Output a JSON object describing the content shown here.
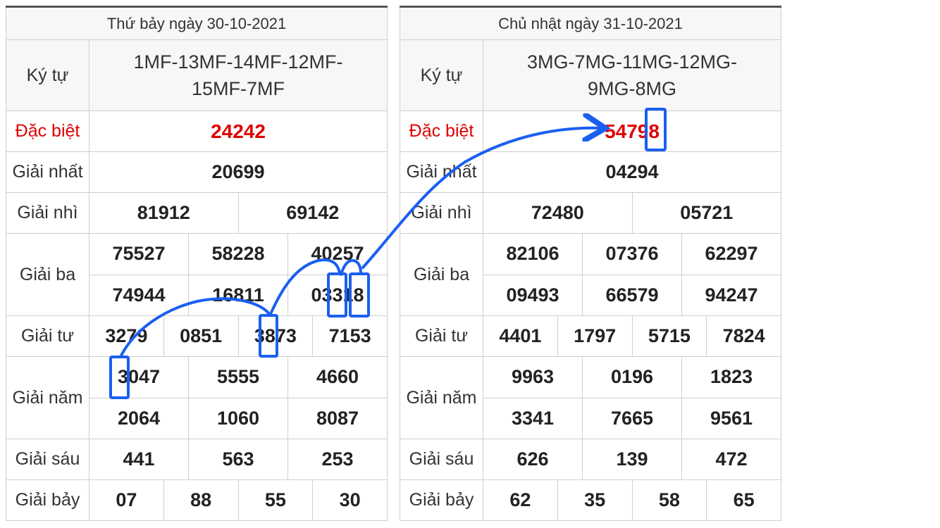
{
  "tables": [
    {
      "date_header": "Thứ bảy ngày 30-10-2021",
      "kytu_label": "Ký tự",
      "kytu_line1": "1MF-13MF-14MF-12MF-",
      "kytu_line2": "15MF-7MF",
      "special_label": "Đặc biệt",
      "special": "24242",
      "first_label": "Giải nhất",
      "first": "20699",
      "second_label": "Giải nhì",
      "second": [
        "81912",
        "69142"
      ],
      "third_label": "Giải ba",
      "third": [
        "75527",
        "58228",
        "40257",
        "74944",
        "16811",
        "03318"
      ],
      "fourth_label": "Giải tư",
      "fourth": [
        "3279",
        "0851",
        "3873",
        "7153"
      ],
      "fifth_label": "Giải năm",
      "fifth": [
        "3047",
        "5555",
        "4660",
        "2064",
        "1060",
        "8087"
      ],
      "sixth_label": "Giải sáu",
      "sixth": [
        "441",
        "563",
        "253"
      ],
      "seventh_label": "Giải bảy",
      "seventh": [
        "07",
        "88",
        "55",
        "30"
      ]
    },
    {
      "date_header": "Chủ nhật ngày 31-10-2021",
      "kytu_label": "Ký tự",
      "kytu_line1": "3MG-7MG-11MG-12MG-",
      "kytu_line2": "9MG-8MG",
      "special_label": "Đặc biệt",
      "special": "54798",
      "first_label": "Giải nhất",
      "first": "04294",
      "second_label": "Giải nhì",
      "second": [
        "72480",
        "05721"
      ],
      "third_label": "Giải ba",
      "third": [
        "82106",
        "07376",
        "62297",
        "09493",
        "66579",
        "94247"
      ],
      "fourth_label": "Giải tư",
      "fourth": [
        "4401",
        "1797",
        "5715",
        "7824"
      ],
      "fifth_label": "Giải năm",
      "fifth": [
        "9963",
        "0196",
        "1823",
        "3341",
        "7665",
        "9561"
      ],
      "sixth_label": "Giải sáu",
      "sixth": [
        "626",
        "139",
        "472"
      ],
      "seventh_label": "Giải bảy",
      "seventh": [
        "62",
        "35",
        "58",
        "65"
      ]
    }
  ],
  "colors": {
    "special_red": "#e00000",
    "annotation_blue": "#1a5ff0",
    "header_bg": "#f7f7f7",
    "grid": "#cfcfcf"
  }
}
